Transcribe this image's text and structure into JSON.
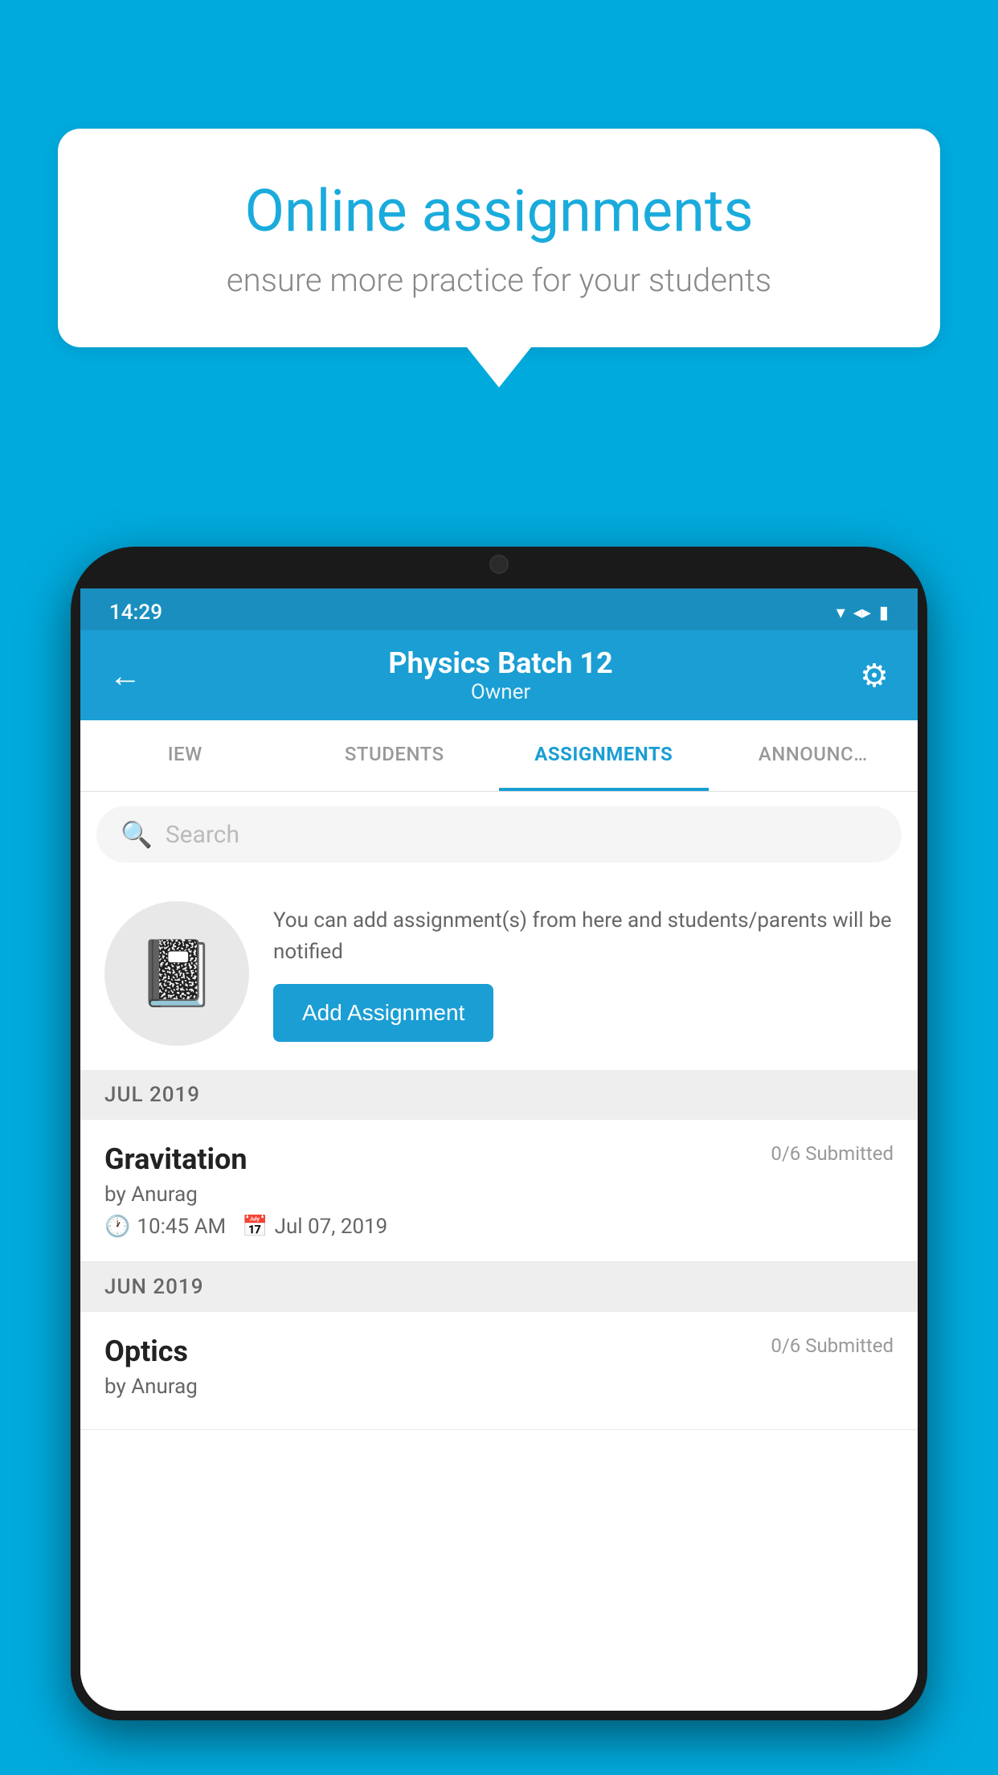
{
  "background": {
    "color": "#00AADD"
  },
  "speech_bubble": {
    "title": "Online assignments",
    "subtitle": "ensure more practice for your students"
  },
  "status_bar": {
    "time": "14:29",
    "icons": [
      "wifi",
      "signal",
      "battery"
    ]
  },
  "header": {
    "title": "Physics Batch 12",
    "subtitle": "Owner",
    "back_label": "←",
    "settings_label": "⚙"
  },
  "tabs": [
    {
      "label": "IEW",
      "active": false
    },
    {
      "label": "STUDENTS",
      "active": false
    },
    {
      "label": "ASSIGNMENTS",
      "active": true
    },
    {
      "label": "ANNOUNCEMENTS",
      "active": false
    }
  ],
  "search": {
    "placeholder": "Search"
  },
  "promo": {
    "description": "You can add assignment(s) from here and students/parents will be notified",
    "button_label": "Add Assignment"
  },
  "sections": [
    {
      "month": "JUL 2019",
      "assignments": [
        {
          "name": "Gravitation",
          "submitted": "0/6 Submitted",
          "by": "by Anurag",
          "time": "10:45 AM",
          "date": "Jul 07, 2019"
        }
      ]
    },
    {
      "month": "JUN 2019",
      "assignments": [
        {
          "name": "Optics",
          "submitted": "0/6 Submitted",
          "by": "by Anurag",
          "time": "",
          "date": ""
        }
      ]
    }
  ]
}
